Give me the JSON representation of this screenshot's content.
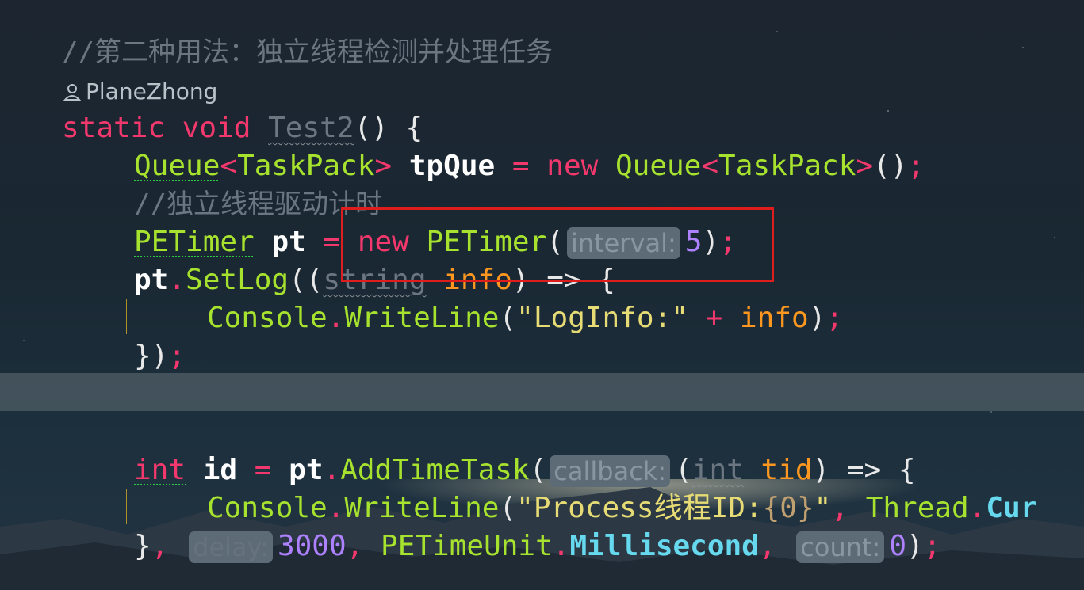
{
  "editor": {
    "comment_line": "//第二种用法：独立线程检测并处理任务",
    "codelens_author": "PlaneZhong",
    "line_method_decl": {
      "static_kw": "static",
      "void_kw": "void",
      "name": "Test2",
      "tail": "() {"
    },
    "line_queue": {
      "type1": "Queue",
      "lt1": "<",
      "gen1": "TaskPack",
      "gt1": ">",
      "var": "tpQue",
      "eq": "=",
      "new_kw": "new",
      "type2": "Queue",
      "lt2": "<",
      "gen2": "TaskPack",
      "gt2": ">",
      "tail": "()",
      "semi": ";"
    },
    "comment_inner": "//独立线程驱动计时",
    "line_timer": {
      "type": "PETimer",
      "var": "pt",
      "eq": "=",
      "new_kw": "new",
      "ctor": "PETimer",
      "open": "(",
      "hint": "interval:",
      "arg": "5",
      "close": ")",
      "semi": ";"
    },
    "line_setlog": {
      "obj": "pt",
      "dot": ".",
      "method": "SetLog",
      "open": "((",
      "ptype": "string",
      "pname": "info",
      "tail": ") => {"
    },
    "line_console1": {
      "cls": "Console",
      "dot": ".",
      "method": "WriteLine",
      "open": "(",
      "str": "\"LogInfo:\"",
      "plus": "+",
      "arg": "info",
      "close": ")",
      "semi": ";"
    },
    "line_close1": {
      "text": "})",
      "semi": ";"
    },
    "line_addtask": {
      "type": "int",
      "var": "id",
      "eq": "=",
      "obj": "pt",
      "dot": ".",
      "method": "AddTimeTask",
      "open": "(",
      "hint": "callback:",
      "lparen": "(",
      "ptype": "int",
      "pname": "tid",
      "tail": ") => {"
    },
    "line_console2": {
      "cls": "Console",
      "dot": ".",
      "method": "WriteLine",
      "open": "(",
      "str_a": "\"Process线程ID:",
      "fmt": "{0}",
      "str_b": "\"",
      "comma": ",",
      "cls2": "Thread",
      "dot2": ".",
      "member": "Cur"
    },
    "line_close2": {
      "brace": "}",
      "comma1": ",",
      "hint_delay": "delay:",
      "arg1": "3000",
      "comma2": ",",
      "enum_type": "PETimeUnit",
      "dot": ".",
      "enum_val": "Millisecond",
      "comma3": ",",
      "hint_count": "count:",
      "arg2": "0",
      "close": ")",
      "semi": ";"
    }
  },
  "colors": {
    "keyword": "#f2386d",
    "type": "#a6e22e",
    "string": "#e6db74",
    "number": "#ae81ff",
    "parameter": "#fd971f",
    "enum": "#66d9ef",
    "comment": "#6b7680",
    "highlight_box": "#e01d1d"
  },
  "icons": {
    "codelens_author": "person-icon"
  }
}
